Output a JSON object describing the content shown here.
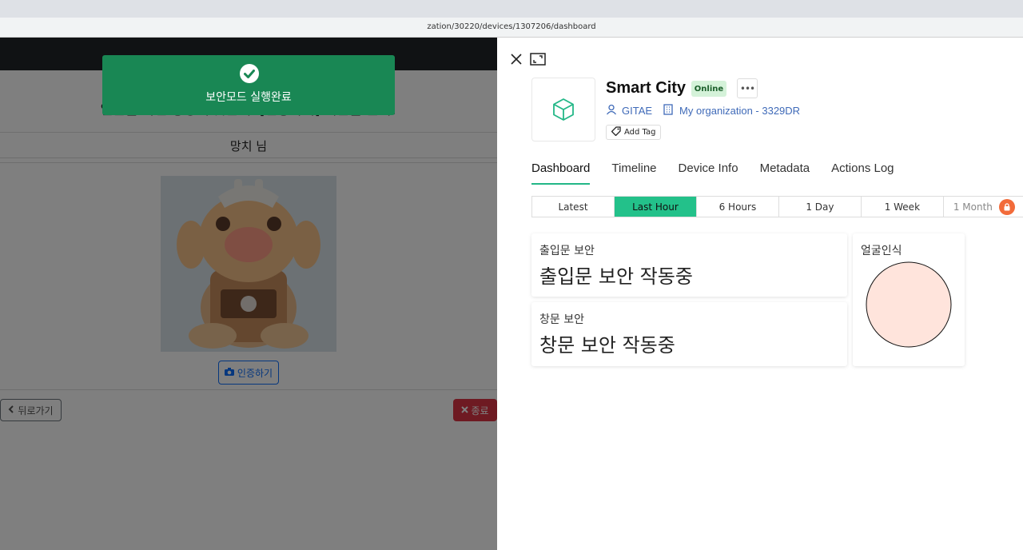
{
  "browser": {
    "url": "zation/30220/devices/1307206/dashboard"
  },
  "left_app": {
    "instruction": "얼굴을 화면 중앙에 맞춘 후 [인증하기] 버튼을 클릭!",
    "username": "망치 님",
    "auth_button": "인증하기",
    "back_button": "뒤로가기",
    "end_button": "종료",
    "toast": "보안모드 실행완료"
  },
  "panel": {
    "device_name": "Smart City",
    "status_badge": "Online",
    "owner": "GITAE",
    "organization": "My organization - 3329DR",
    "add_tag": "Add Tag",
    "tabs": [
      "Dashboard",
      "Timeline",
      "Device Info",
      "Metadata",
      "Actions Log"
    ],
    "active_tab": "Dashboard",
    "time_ranges": [
      "Latest",
      "Last Hour",
      "6 Hours",
      "1 Day",
      "1 Week",
      "1 Month"
    ],
    "active_range": "Last Hour",
    "widgets": [
      {
        "label": "출입문 보안",
        "value": "출입문 보안 작동중"
      },
      {
        "label": "창문 보안",
        "value": "창문 보안 작동중"
      },
      {
        "label": "얼굴인식"
      }
    ]
  },
  "colors": {
    "accent": "#23c18a",
    "toast": "#198754",
    "danger": "#dc3545",
    "link": "#3f6ab8",
    "indicator": "#ffe4dc"
  }
}
